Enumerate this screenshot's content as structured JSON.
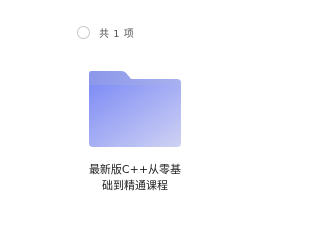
{
  "selection": {
    "count_label": "共 1 项"
  },
  "items": [
    {
      "type": "folder",
      "name_line1": "最新版C++从零基",
      "name_line2": "础到精通课程"
    }
  ],
  "colors": {
    "folder_back": "#8f9ce8",
    "folder_front_start": "#7f8df5",
    "folder_front_end": "#c9cdf2"
  }
}
